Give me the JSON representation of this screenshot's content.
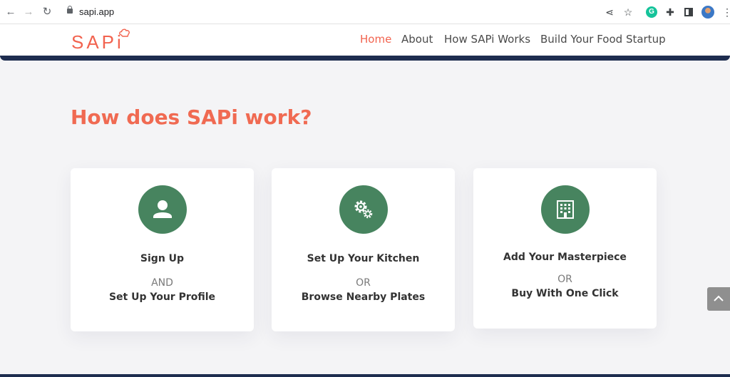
{
  "browser": {
    "url": "sapi.app"
  },
  "site": {
    "logo": "SAPi",
    "nav": [
      "Home",
      "About",
      "How SAPi Works",
      "Build Your Food Startup"
    ],
    "active_nav": "Home"
  },
  "main": {
    "heading": "How does SAPi work?",
    "cards": [
      {
        "icon": "user-icon",
        "title": "Sign Up",
        "or": "AND",
        "subtitle": "Set Up Your Profile"
      },
      {
        "icon": "gears-icon",
        "title": "Set Up Your Kitchen",
        "or": "OR",
        "subtitle": "Browse Nearby Plates"
      },
      {
        "icon": "building-icon",
        "title": "Add Your Masterpiece",
        "or": "OR",
        "subtitle": "Buy With One Click"
      }
    ]
  },
  "colors": {
    "accent": "#f2634f",
    "icon_green": "#47845f",
    "navy": "#1e2d4f"
  }
}
